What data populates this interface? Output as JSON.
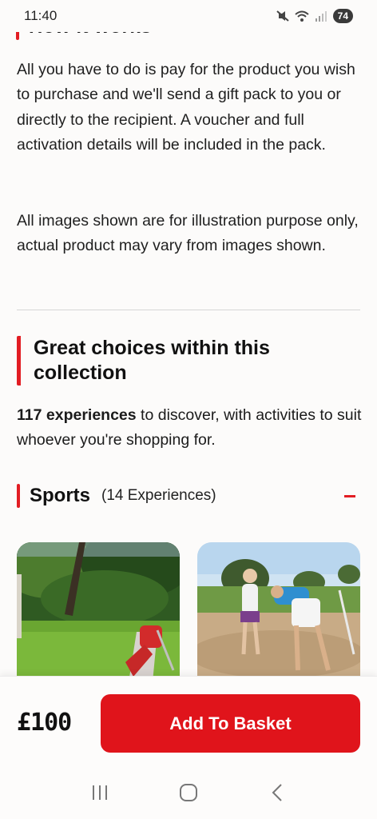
{
  "status_bar": {
    "time": "11:40",
    "battery": "74"
  },
  "section_partial_heading": "How it works",
  "paragraphs": [
    "All you have to do is pay for the product you wish to purchase and we'll send a gift pack to you or directly to the recipient. A voucher and full activation details will be included in the pack.",
    "All images shown are for illustration purpose only, actual product may vary from images shown."
  ],
  "collection": {
    "title": "Great choices within this collection",
    "count_bold": "117 experiences",
    "count_rest": " to discover, with activities to suit whoever you're shopping for."
  },
  "category": {
    "name": "Sports",
    "count": "(14 Experiences)",
    "toggle": "−"
  },
  "cards": [
    {
      "image": "golf-course-bag-photo"
    },
    {
      "image": "golf-bunker-lesson-photo"
    }
  ],
  "purchase": {
    "price": "£100",
    "button_label": "Add To Basket"
  },
  "nav": {
    "recents": "recents-icon",
    "home": "home-icon",
    "back": "back-icon"
  },
  "colors": {
    "accent": "#e0141b",
    "background": "#fcfbfa"
  }
}
